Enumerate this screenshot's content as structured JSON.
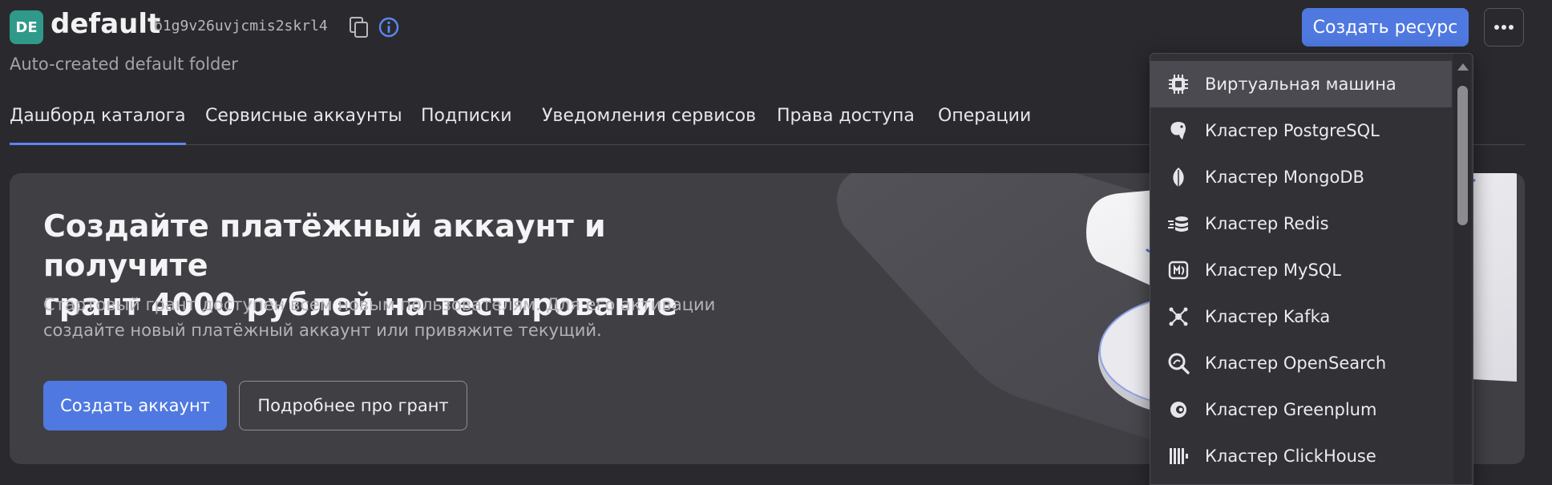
{
  "header": {
    "avatar_initials": "DE",
    "folder_name": "default",
    "folder_id": "b1g9v26uvjcmis2skrl4",
    "description": "Auto-created default folder",
    "create_resource_label": "Создать ресурс",
    "copy_icon": "copy-icon",
    "info_icon": "info-icon",
    "more_icon": "ellipsis-icon"
  },
  "tabs": [
    {
      "label": "Дашборд каталога",
      "active": true
    },
    {
      "label": "Сервисные аккаунты",
      "active": false
    },
    {
      "label": "Подписки",
      "active": false
    },
    {
      "label": "Уведомления сервисов",
      "active": false
    },
    {
      "label": "Права доступа",
      "active": false
    },
    {
      "label": "Операции",
      "active": false
    }
  ],
  "banner": {
    "title_line1": "Создайте платёжный аккаунт и получите",
    "title_line2": "грант 4000 рублей на тестирование",
    "text_line1": "Стартовый грант доступен всем новым пользователям. Для его активации",
    "text_line2": "создайте новый платёжный аккаунт или привяжите текущий.",
    "create_account_label": "Создать аккаунт",
    "more_grant_label": "Подробнее про грант"
  },
  "dropdown": {
    "items": [
      {
        "label": "Виртуальная машина",
        "icon": "chip-icon",
        "selected": true
      },
      {
        "label": "Кластер PostgreSQL",
        "icon": "postgresql-icon",
        "selected": false
      },
      {
        "label": "Кластер MongoDB",
        "icon": "mongodb-leaf-icon",
        "selected": false
      },
      {
        "label": "Кластер Redis",
        "icon": "redis-icon",
        "selected": false
      },
      {
        "label": "Кластер MySQL",
        "icon": "mysql-icon",
        "selected": false
      },
      {
        "label": "Кластер Kafka",
        "icon": "kafka-icon",
        "selected": false
      },
      {
        "label": "Кластер OpenSearch",
        "icon": "opensearch-icon",
        "selected": false
      },
      {
        "label": "Кластер Greenplum",
        "icon": "greenplum-icon",
        "selected": false
      },
      {
        "label": "Кластер ClickHouse",
        "icon": "clickhouse-icon",
        "selected": false
      }
    ]
  },
  "colors": {
    "background": "#2a2a2e",
    "accent": "#4f79e0",
    "banner": "#3f3f44",
    "avatar": "#2f9a8a",
    "dropdown": "#313136"
  }
}
